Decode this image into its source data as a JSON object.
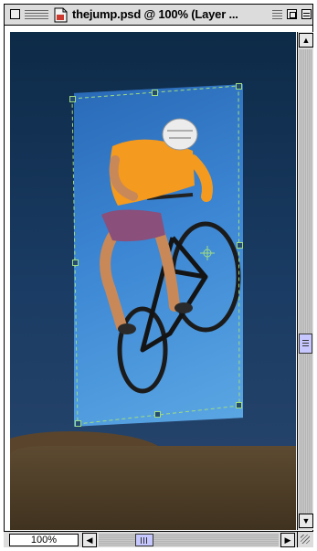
{
  "window": {
    "title": "thejump.psd @ 100% (Layer ...",
    "zoom_level": "100%"
  },
  "icons": {
    "close": "close-box-icon",
    "menu": "window-menu-icon",
    "document": "document-icon",
    "zoom": "zoom-box-icon",
    "collapse": "collapse-box-icon",
    "up": "scroll-up-arrow-icon",
    "down": "scroll-down-arrow-icon",
    "left": "scroll-left-arrow-icon",
    "right": "scroll-right-arrow-icon",
    "grow": "resize-grip-icon"
  },
  "scroll": {
    "vertical_position": 0.62,
    "horizontal_position": 0.24
  },
  "colors": {
    "canvas_sky_top": "#0d2a47",
    "photo_blue": "#3c86d3",
    "transform_box": "#9fdc80",
    "scroll_thumb": "#c7c7ff"
  }
}
